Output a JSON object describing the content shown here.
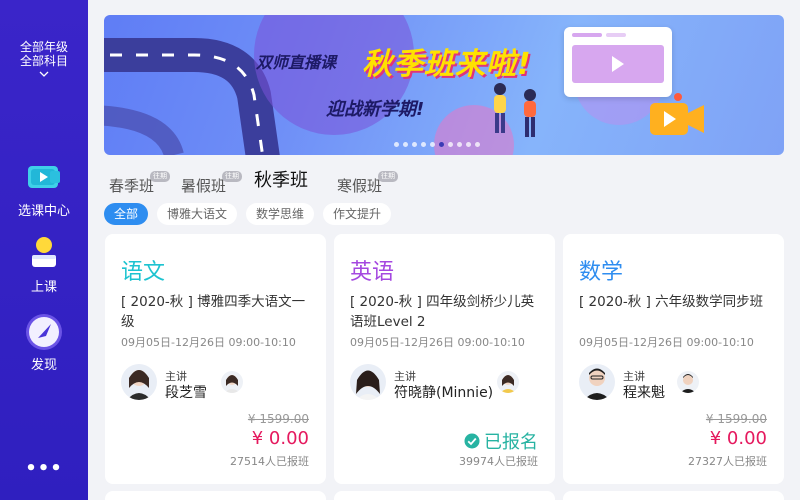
{
  "sidebar": {
    "grade_line1": "全部年级",
    "grade_line2": "全部科目",
    "items": [
      {
        "label": "选课中心",
        "icon": "video-course-icon"
      },
      {
        "label": "上课",
        "icon": "person-class-icon"
      },
      {
        "label": "发现",
        "icon": "compass-icon"
      }
    ],
    "more": "•••"
  },
  "banner": {
    "tag": "双师直播课",
    "headline": "秋季班来啦!",
    "subline": "迎战新学期!",
    "slide_count": 10,
    "active_slide": 5
  },
  "terms": [
    {
      "label": "春季班",
      "tag": "往期"
    },
    {
      "label": "暑假班",
      "tag": "往期"
    },
    {
      "label": "秋季班",
      "tag": ""
    },
    {
      "label": "寒假班",
      "tag": "往期"
    }
  ],
  "filters": [
    "全部",
    "博雅大语文",
    "数学思维",
    "作文提升"
  ],
  "courses": [
    {
      "subject": "语文",
      "subject_color": "#1dc3d0",
      "title": "[ 2020-秋 ] 博雅四季大语文一级",
      "date": "09月05日-12月26日 09:00-10:10",
      "role": "主讲",
      "teacher": "段芝雪",
      "original_price": "¥ 1599.00",
      "price": "¥ 0.00",
      "enrolled": "",
      "count": "27514人已报班"
    },
    {
      "subject": "英语",
      "subject_color": "#a548e0",
      "title": "[ 2020-秋 ] 四年级剑桥少儿英语班Level 2",
      "date": "09月05日-12月26日 09:00-10:10",
      "role": "主讲",
      "teacher": "符晓静(Minnie)",
      "original_price": "",
      "price": "",
      "enrolled": "已报名",
      "count": "39974人已报班"
    },
    {
      "subject": "数学",
      "subject_color": "#2e8df0",
      "title": "[ 2020-秋 ] 六年级数学同步班",
      "date": "09月05日-12月26日 09:00-10:10",
      "role": "主讲",
      "teacher": "程来魁",
      "original_price": "¥ 1599.00",
      "price": "¥ 0.00",
      "enrolled": "",
      "count": "27327人已报班"
    }
  ],
  "colors": {
    "sidebar": "#3a25c9",
    "accent": "#2e8df0",
    "price": "#e5195e",
    "enrolled": "#27b3a2"
  }
}
